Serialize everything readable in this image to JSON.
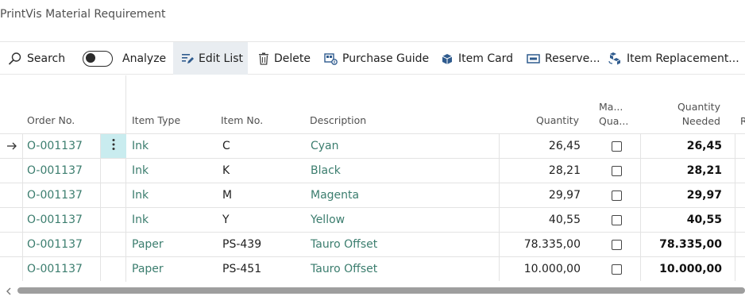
{
  "page": {
    "title": "PrintVis Material Requirement"
  },
  "toolbar": {
    "search_label": "Search",
    "analyze_label": "Analyze",
    "edit_list_label": "Edit List",
    "delete_label": "Delete",
    "purchase_guide_label": "Purchase Guide",
    "item_card_label": "Item Card",
    "reserve_label": "Reserve...",
    "item_replacement_label": "Item Replacement..."
  },
  "table": {
    "columns": {
      "order_no": "Order No.",
      "item_type": "Item Type",
      "item_no": "Item No.",
      "description": "Description",
      "quantity": "Quantity",
      "ma_line1": "Ma...",
      "ma_line2": "Qua...",
      "qty_needed_line1": "Quantity",
      "qty_needed_line2": "Needed",
      "cut_off": "R"
    },
    "rows": [
      {
        "order_no": "O-001137",
        "item_type": "Ink",
        "item_no": "C",
        "description": "Cyan",
        "quantity": "26,45",
        "checked": false,
        "quantity_needed": "26,45",
        "current": true
      },
      {
        "order_no": "O-001137",
        "item_type": "Ink",
        "item_no": "K",
        "description": "Black",
        "quantity": "28,21",
        "checked": false,
        "quantity_needed": "28,21",
        "current": false
      },
      {
        "order_no": "O-001137",
        "item_type": "Ink",
        "item_no": "M",
        "description": "Magenta",
        "quantity": "29,97",
        "checked": false,
        "quantity_needed": "29,97",
        "current": false
      },
      {
        "order_no": "O-001137",
        "item_type": "Ink",
        "item_no": "Y",
        "description": "Yellow",
        "quantity": "40,55",
        "checked": false,
        "quantity_needed": "40,55",
        "current": false
      },
      {
        "order_no": "O-001137",
        "item_type": "Paper",
        "item_no": "PS-439",
        "description": "Tauro Offset",
        "quantity": "78.335,00",
        "checked": false,
        "quantity_needed": "78.335,00",
        "current": false
      },
      {
        "order_no": "O-001137",
        "item_type": "Paper",
        "item_no": "PS-451",
        "description": "Tauro Offset",
        "quantity": "10.000,00",
        "checked": false,
        "quantity_needed": "10.000,00",
        "current": false
      }
    ]
  },
  "colors": {
    "link": "#3b7d6e",
    "active_toolbar_bg": "#e9edf1",
    "selected_cell_bg": "#c9ecef",
    "icon_blue": "#2f5b8e"
  },
  "icons": {
    "search": "search-icon",
    "edit_list": "edit-list-icon",
    "delete": "trash-icon",
    "purchase_guide": "purchase-guide-icon",
    "item_card": "item-card-icon",
    "reserve": "reserve-icon",
    "item_replacement": "item-replacement-icon",
    "row_indicator": "arrow-right-icon",
    "row_actions": "more-vertical-icon"
  }
}
